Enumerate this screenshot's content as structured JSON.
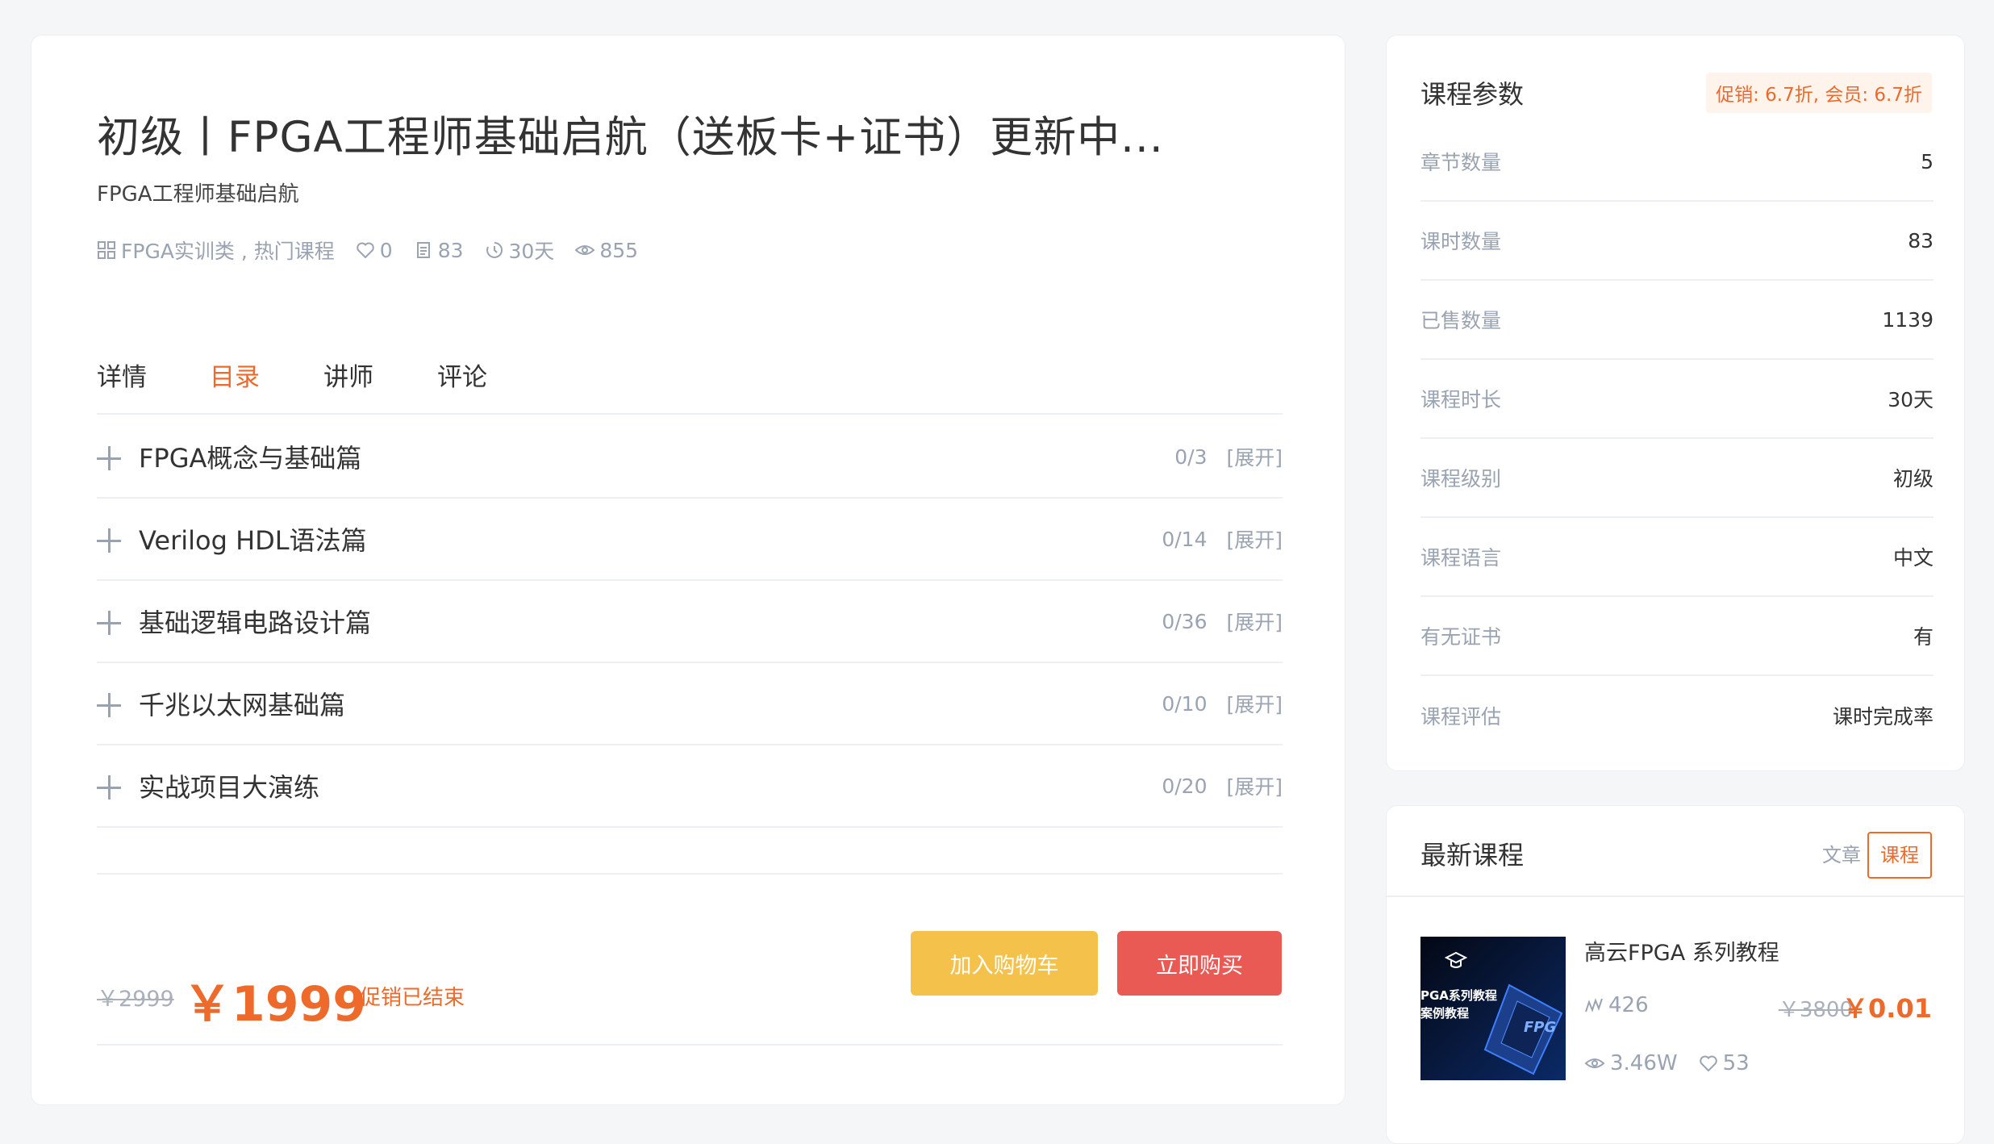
{
  "course": {
    "title": "初级丨FPGA工程师基础启航（送板卡+证书）更新中...",
    "subtitle": "FPGA工程师基础启航",
    "category": "FPGA实训类 , 热门课程",
    "likes": "0",
    "lessons": "83",
    "duration": "30天",
    "views": "855"
  },
  "tabs": [
    "详情",
    "目录",
    "讲师",
    "评论"
  ],
  "active_tab": "目录",
  "chapters": [
    {
      "name": "FPGA概念与基础篇",
      "progress": "0/3",
      "expand": "[展开]"
    },
    {
      "name": "Verilog HDL语法篇",
      "progress": "0/14",
      "expand": "[展开]"
    },
    {
      "name": "基础逻辑电路设计篇",
      "progress": "0/36",
      "expand": "[展开]"
    },
    {
      "name": "千兆以太网基础篇",
      "progress": "0/10",
      "expand": "[展开]"
    },
    {
      "name": "实战项目大演练",
      "progress": "0/20",
      "expand": "[展开]"
    }
  ],
  "pricing": {
    "old_price": "￥2999",
    "price": "￥1999",
    "promo_status": "促销已结束",
    "cart_label": "加入购物车",
    "buy_label": "立即购买"
  },
  "params": {
    "title": "课程参数",
    "discount": "促销: 6.7折, 会员: 6.7折",
    "rows": [
      {
        "k": "章节数量",
        "v": "5"
      },
      {
        "k": "课时数量",
        "v": "83"
      },
      {
        "k": "已售数量",
        "v": "1139"
      },
      {
        "k": "课程时长",
        "v": "30天"
      },
      {
        "k": "课程级别",
        "v": "初级"
      },
      {
        "k": "课程语言",
        "v": "中文"
      },
      {
        "k": "有无证书",
        "v": "有"
      },
      {
        "k": "课程评估",
        "v": "课时完成率"
      }
    ]
  },
  "latest": {
    "title": "最新课程",
    "tab_article": "文章",
    "tab_course": "课程",
    "item": {
      "title": "高云FPGA 系列教程",
      "students": "426",
      "old_price": "￥3800",
      "price": "￥0.01",
      "views": "3.46W",
      "likes": "53",
      "thumb_line1": "PGA系列教程",
      "thumb_line2": "案例教程",
      "thumb_chip": "FPG"
    }
  },
  "colors": {
    "accent": "#ee6a2b",
    "cart": "#f4c24a",
    "buy": "#ea5a55",
    "muted": "#9aa3b2"
  }
}
